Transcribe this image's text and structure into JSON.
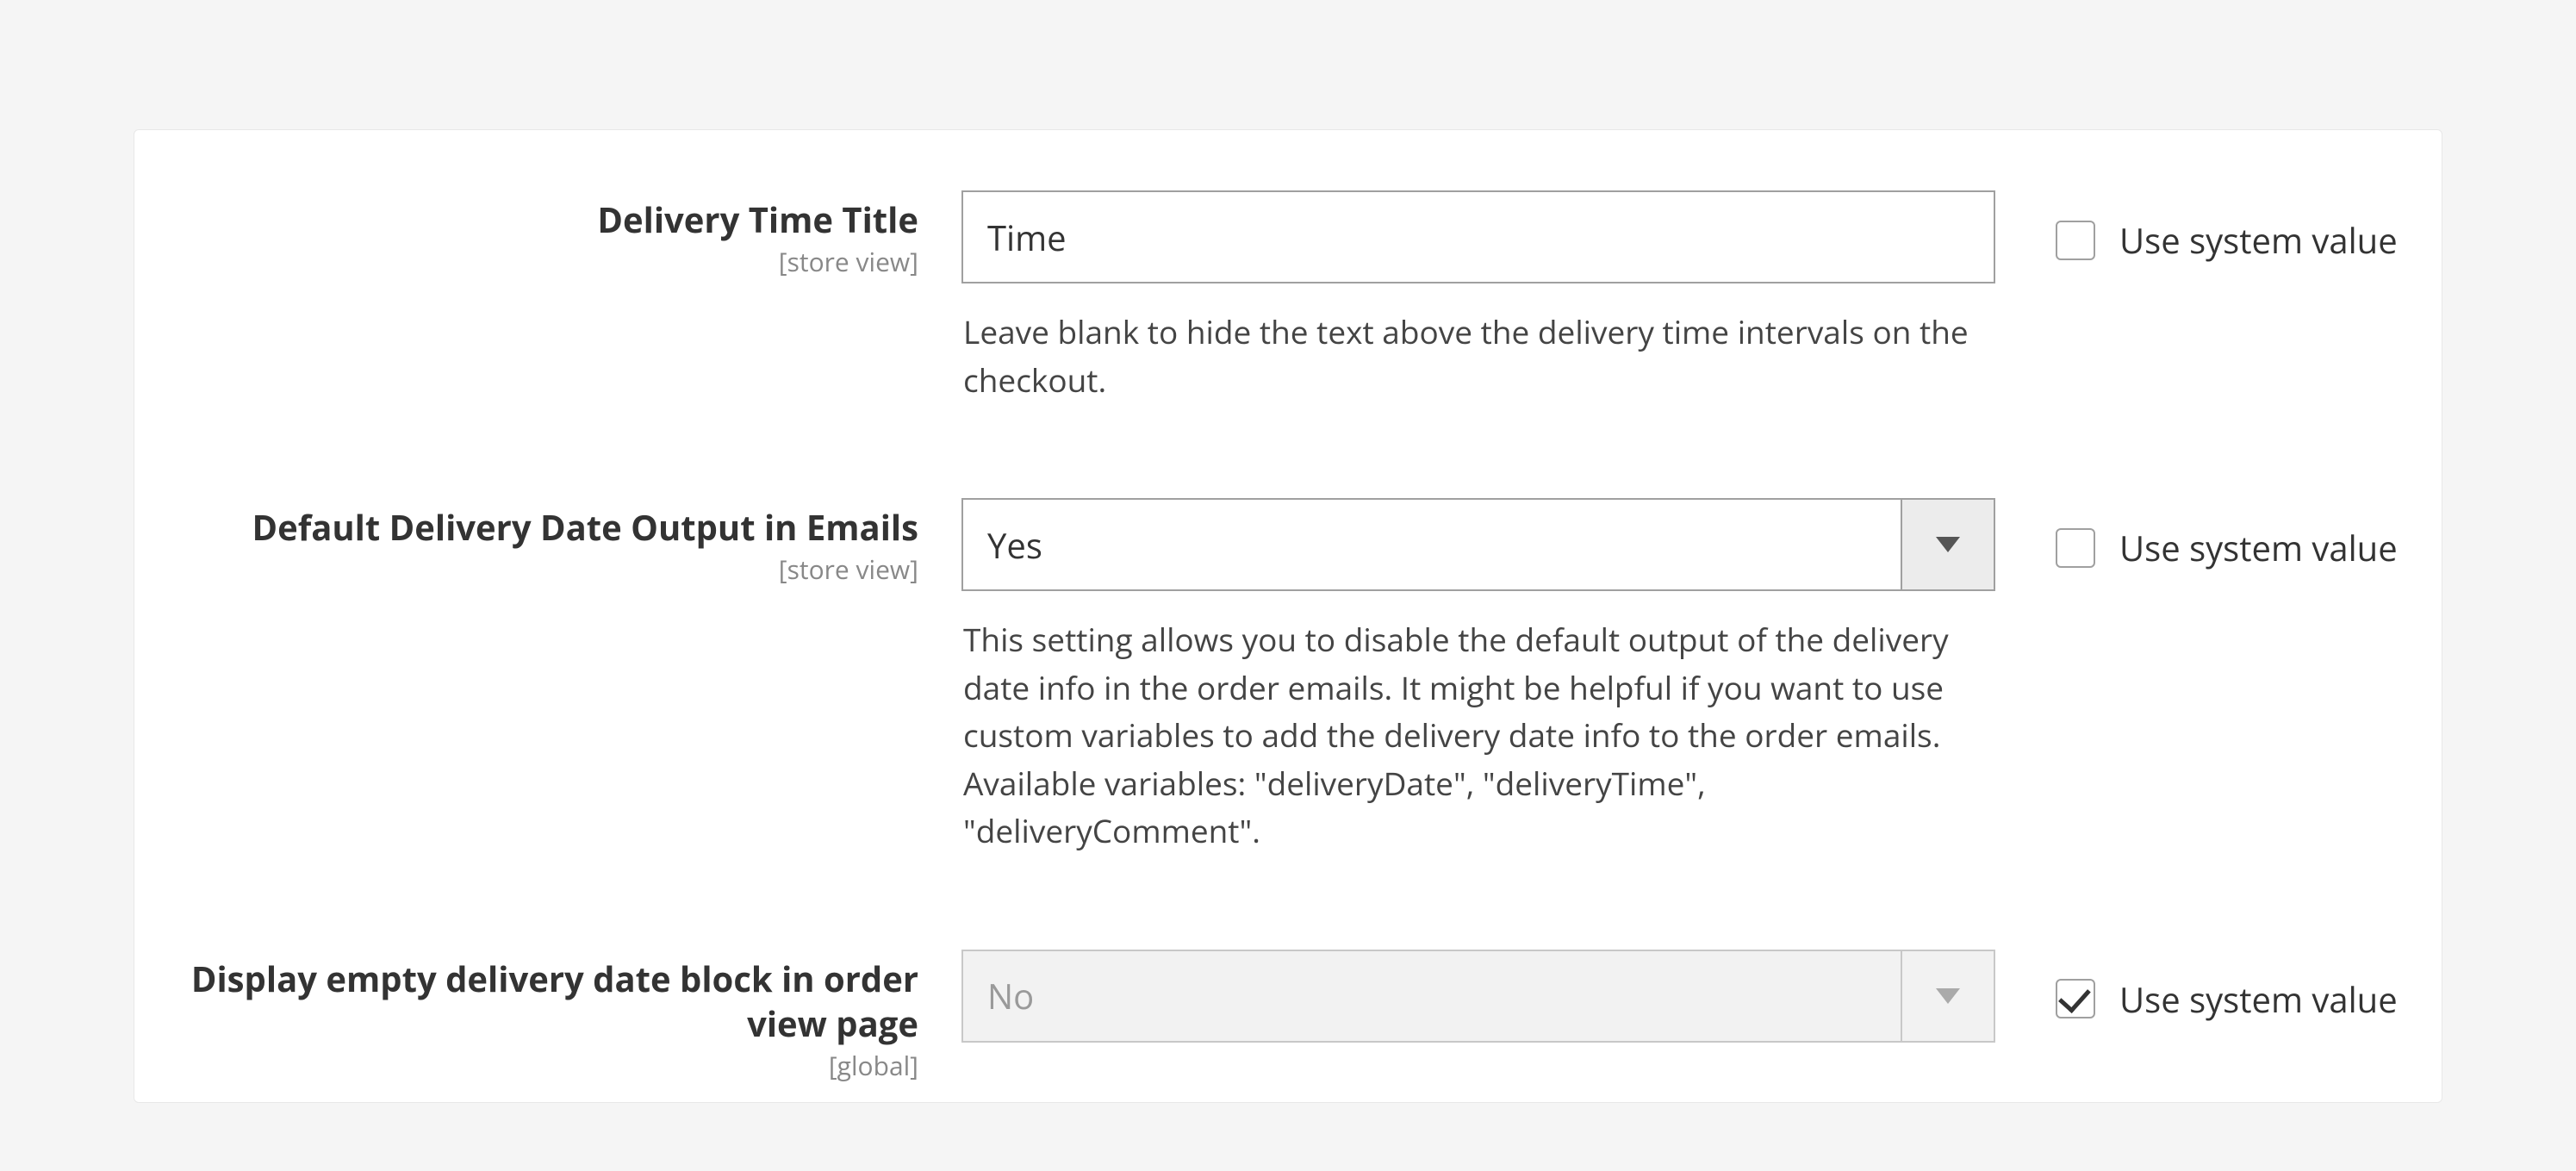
{
  "common": {
    "use_system_value": "Use system value"
  },
  "fields": {
    "deliveryTimeTitle": {
      "label": "Delivery Time Title",
      "scope": "[store view]",
      "value": "Time",
      "note": "Leave blank to hide the text above the delivery time intervals on the checkout.",
      "use_system": false
    },
    "defaultEmailOutput": {
      "label": "Default Delivery Date Output in Emails",
      "scope": "[store view]",
      "value": "Yes",
      "note": "This setting allows you to disable the default output of the delivery date info in the order emails. It might be helpful if you want to use custom variables to add the delivery date info to the order emails. Available variables: \"deliveryDate\", \"deliveryTime\", \"deliveryComment\".",
      "use_system": false
    },
    "displayEmptyBlock": {
      "label": "Display empty delivery date block in order view page",
      "scope": "[global]",
      "value": "No",
      "use_system": true
    }
  }
}
